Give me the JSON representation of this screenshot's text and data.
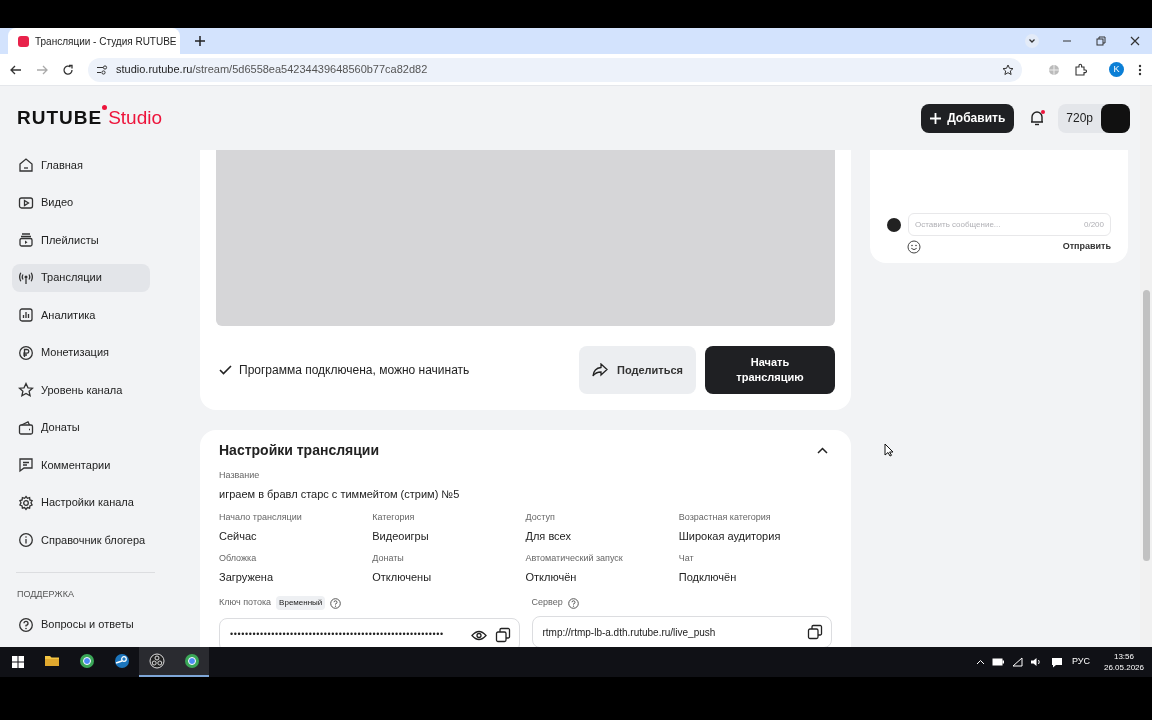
{
  "browser": {
    "tab_title": "Трансляции - Студия RUTUBE",
    "url_host": "studio.rutube.ru",
    "url_path": "/stream/5d6558ea54234439648560b77ca82d82",
    "profile_letter": "K"
  },
  "header": {
    "logo_main": "RUTUBE",
    "logo_sub": "Studio",
    "add_button": "Добавить",
    "notification_unread": true,
    "quality": "720p"
  },
  "sidebar": {
    "items": [
      {
        "label": "Главная",
        "kind": "home",
        "selected": false
      },
      {
        "label": "Видео",
        "kind": "video",
        "selected": false
      },
      {
        "label": "Плейлисты",
        "kind": "playlist",
        "selected": false
      },
      {
        "label": "Трансляции",
        "kind": "broadcast",
        "selected": true
      },
      {
        "label": "Аналитика",
        "kind": "analytics",
        "selected": false
      },
      {
        "label": "Монетизация",
        "kind": "ruble",
        "selected": false
      },
      {
        "label": "Уровень канала",
        "kind": "star",
        "selected": false
      },
      {
        "label": "Донаты",
        "kind": "wallet",
        "selected": false
      },
      {
        "label": "Комментарии",
        "kind": "comment",
        "selected": false
      },
      {
        "label": "Настройки канала",
        "kind": "gear",
        "selected": false
      },
      {
        "label": "Справочник блогера",
        "kind": "info",
        "selected": false
      }
    ],
    "section_title": "ПОДДЕРЖКА",
    "support_items": [
      {
        "label": "Вопросы и ответы",
        "kind": "help",
        "selected": false
      }
    ]
  },
  "stream": {
    "status": "Программа подключена, можно начинать",
    "share_button": "Поделиться",
    "start_button": "Начать трансляцию"
  },
  "settings": {
    "title": "Настройки трансляции",
    "expanded": true,
    "name_label": "Название",
    "name_value": "играем в бравл старс с тиммейтом (стрим) №5",
    "fields": [
      {
        "label": "Начало трансляции",
        "value": "Сейчас"
      },
      {
        "label": "Категория",
        "value": "Видеоигры"
      },
      {
        "label": "Доступ",
        "value": "Для всех"
      },
      {
        "label": "Возрастная категория",
        "value": "Широкая аудитория"
      },
      {
        "label": "Обложка",
        "value": "Загружена"
      },
      {
        "label": "Донаты",
        "value": "Отключены"
      },
      {
        "label": "Автоматический запуск",
        "value": "Отключён"
      },
      {
        "label": "Чат",
        "value": "Подключён"
      }
    ],
    "key": {
      "label": "Ключ потока",
      "badge": "Временный",
      "value": "•••••••••••••••••••••••••••••••••••••••••••••••••••••••••"
    },
    "server": {
      "label": "Сервер",
      "value": "rtmp://rtmp-lb-a.dth.rutube.ru/live_push"
    }
  },
  "chat": {
    "placeholder": "Оставить сообщение...",
    "counter": "0/200",
    "send_button": "Отправить"
  },
  "taskbar": {
    "items": [
      {
        "kind": "folder",
        "active": false
      },
      {
        "kind": "globe",
        "active": false
      },
      {
        "kind": "steam",
        "active": false
      },
      {
        "kind": "obs",
        "active": true
      },
      {
        "kind": "globe",
        "active": true
      }
    ],
    "language": "РУС",
    "time": "13:56",
    "date": "26.05.2026"
  }
}
